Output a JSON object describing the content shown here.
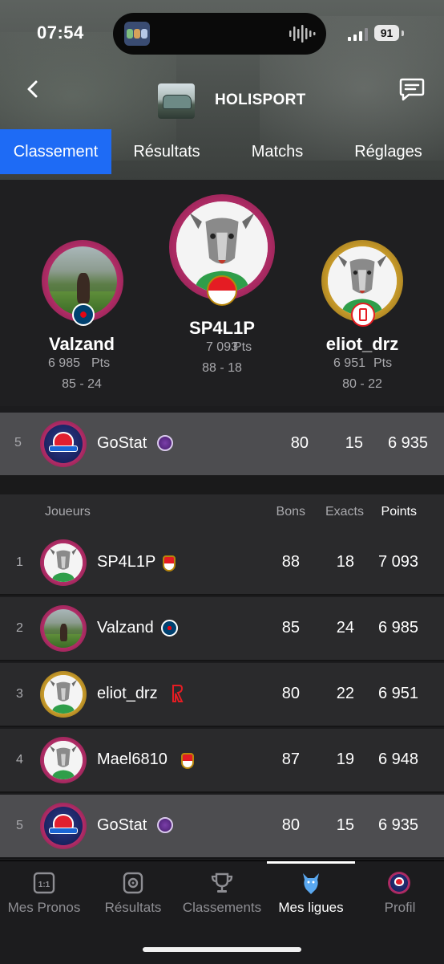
{
  "status_bar": {
    "time": "07:54",
    "battery": "91"
  },
  "header": {
    "league_title": "HOLISPORT",
    "back_icon": "chevron-left-icon",
    "chat_icon": "chat-bubble-icon"
  },
  "tabs": [
    {
      "label": "Classement",
      "active": true
    },
    {
      "label": "Résultats",
      "active": false
    },
    {
      "label": "Matchs",
      "active": false
    },
    {
      "label": "Réglages",
      "active": false
    }
  ],
  "podium": {
    "first": {
      "name": "SP4L1P",
      "points": "7 093",
      "pts_unit": "Pts",
      "record": "88 - 18",
      "club": "monaco"
    },
    "second": {
      "name": "Valzand",
      "points": "6 985",
      "pts_unit": "Pts",
      "record": "85 - 24",
      "club": "psg"
    },
    "third": {
      "name": "eliot_drz",
      "points": "6 951",
      "pts_unit": "Pts",
      "record": "80 - 22",
      "club": "reims"
    }
  },
  "my_row": {
    "rank": "5",
    "name": "GoStat",
    "bons": "80",
    "exacts": "15",
    "points": "6 935"
  },
  "table": {
    "headers": {
      "player": "Joueurs",
      "bons": "Bons",
      "exacts": "Exacts",
      "points": "Points"
    },
    "rows": [
      {
        "rank": "1",
        "name": "SP4L1P",
        "bons": "88",
        "exacts": "18",
        "points": "7 093",
        "club": "monaco"
      },
      {
        "rank": "2",
        "name": "Valzand",
        "bons": "85",
        "exacts": "24",
        "points": "6 985",
        "club": "psg"
      },
      {
        "rank": "3",
        "name": "eliot_drz",
        "bons": "80",
        "exacts": "22",
        "points": "6 951",
        "club": "reims"
      },
      {
        "rank": "4",
        "name": "Mael6810",
        "bons": "87",
        "exacts": "19",
        "points": "6 948",
        "club": "monaco"
      },
      {
        "rank": "5",
        "name": "GoStat",
        "bons": "80",
        "exacts": "15",
        "points": "6 935",
        "club": "toulouse"
      }
    ]
  },
  "bottom_nav": [
    {
      "label": "Mes Pronos",
      "icon": "one-one-box-icon",
      "active": false
    },
    {
      "label": "Résultats",
      "icon": "whistle-icon",
      "active": false
    },
    {
      "label": "Classements",
      "icon": "trophy-icon",
      "active": false
    },
    {
      "label": "Mes ligues",
      "icon": "goat-icon",
      "active": true
    },
    {
      "label": "Profil",
      "icon": "profile-avatar-icon",
      "active": false
    }
  ],
  "colors": {
    "accent": "#1e6bf5",
    "ring_pink": "#b02c66",
    "ring_gold": "#c79a2a",
    "muted_text": "#a9a9ad"
  }
}
